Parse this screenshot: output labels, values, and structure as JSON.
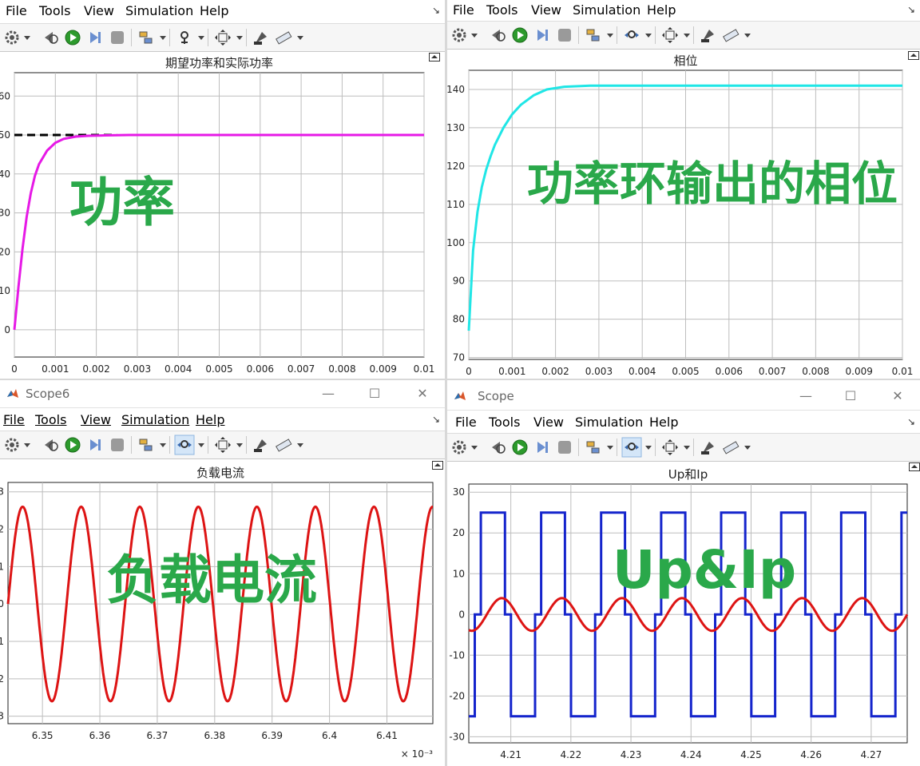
{
  "menu": {
    "file": "File",
    "tools": "Tools",
    "view": "View",
    "simulation": "Simulation",
    "help": "Help"
  },
  "windows": {
    "scope6_title": "Scope6",
    "scope_title": "Scope",
    "minimize_glyph": "—",
    "maximize_glyph": "☐",
    "close_glyph": "✕",
    "dock_glyph": "↘"
  },
  "chart_data": [
    {
      "id": "power",
      "type": "line",
      "title": "期望功率和实际功率",
      "overlay": "功率",
      "xlim": [
        0,
        0.01
      ],
      "ylim": [
        -7,
        66
      ],
      "xticks": [
        0,
        0.001,
        0.002,
        0.003,
        0.004,
        0.005,
        0.006,
        0.007,
        0.008,
        0.009,
        0.01
      ],
      "xticklabels": [
        "0",
        "0.001",
        "0.002",
        "0.003",
        "0.004",
        "0.005",
        "0.006",
        "0.007",
        "0.008",
        "0.009",
        "0.01"
      ],
      "yticks": [
        0,
        10,
        20,
        30,
        40,
        50,
        60
      ],
      "yticklabels": [
        "0",
        "10",
        "20",
        "30",
        "40",
        "50",
        "60"
      ],
      "grid": true,
      "series": [
        {
          "color": "#000000",
          "dash": "10,6",
          "x": [
            0,
            0.0025
          ],
          "y": [
            50,
            50
          ]
        },
        {
          "color": "#e619e6",
          "x": [
            0,
            0.0001,
            0.0002,
            0.0003,
            0.0004,
            0.0005,
            0.0006,
            0.0008,
            0.001,
            0.0012,
            0.0015,
            0.0018,
            0.0022,
            0.0028,
            0.0035,
            0.0045,
            0.006,
            0.008,
            0.01
          ],
          "y": [
            0,
            11,
            21,
            29,
            35,
            39.5,
            42.5,
            46,
            48,
            49,
            49.6,
            49.8,
            49.9,
            50,
            50,
            50,
            50,
            50,
            50
          ]
        }
      ]
    },
    {
      "id": "phase",
      "type": "line",
      "title": "相位",
      "overlay": "功率环输出的相位",
      "xlim": [
        0,
        0.01
      ],
      "ylim": [
        69.5,
        145
      ],
      "xticks": [
        0,
        0.001,
        0.002,
        0.003,
        0.004,
        0.005,
        0.006,
        0.007,
        0.008,
        0.009,
        0.01
      ],
      "xticklabels": [
        "0",
        "0.001",
        "0.002",
        "0.003",
        "0.004",
        "0.005",
        "0.006",
        "0.007",
        "0.008",
        "0.009",
        "0.01"
      ],
      "yticks": [
        70,
        80,
        90,
        100,
        110,
        120,
        130,
        140
      ],
      "yticklabels": [
        "70",
        "80",
        "90",
        "100",
        "110",
        "120",
        "130",
        "140"
      ],
      "grid": true,
      "series": [
        {
          "color": "#20e6e6",
          "x": [
            0,
            0.0001,
            0.0002,
            0.0003,
            0.0004,
            0.0005,
            0.0006,
            0.0008,
            0.001,
            0.0012,
            0.0015,
            0.0018,
            0.0022,
            0.0028,
            0.0035,
            0.0045,
            0.006,
            0.008,
            0.01
          ],
          "y": [
            77,
            98,
            108,
            114.5,
            119,
            122.5,
            125.5,
            130,
            133.5,
            136,
            138.5,
            140,
            140.7,
            141,
            141,
            141,
            141,
            141,
            141
          ]
        }
      ]
    },
    {
      "id": "current",
      "type": "line",
      "title": "负载电流",
      "overlay": "负载电流",
      "xlim": [
        0.006344,
        0.006418
      ],
      "ylim": [
        -3.2,
        3.25
      ],
      "xticks": [
        0.00635,
        0.00636,
        0.00637,
        0.00638,
        0.00639,
        0.0064,
        0.00641
      ],
      "xticklabels": [
        "6.35",
        "6.36",
        "6.37",
        "6.38",
        "6.39",
        "6.4",
        "6.41"
      ],
      "yticks": [
        3,
        2,
        1,
        0,
        -1,
        -2,
        -3
      ],
      "yticklabels": [
        "3",
        "2",
        "1",
        "0",
        "1",
        "2",
        "3"
      ],
      "xexponent": "× 10⁻³",
      "grid": true,
      "series": [
        {
          "color": "#dd1414",
          "function": "sine",
          "amplitude": 2.6,
          "period": 1.02e-05,
          "phase_x": 0.006344
        }
      ]
    },
    {
      "id": "upip",
      "type": "line",
      "title": "Up和Ip",
      "overlay": "Up&Ip",
      "xlim": [
        0.04203,
        0.04276
      ],
      "ylim": [
        -31.5,
        32
      ],
      "xticks": [
        0.0421,
        0.0422,
        0.0423,
        0.0424,
        0.0425,
        0.0426,
        0.0427
      ],
      "xticklabels": [
        "4.21",
        "4.22",
        "4.23",
        "4.24",
        "4.25",
        "4.26",
        "4.27"
      ],
      "yticks": [
        30,
        20,
        10,
        0,
        -10,
        -20,
        -30
      ],
      "yticklabels": [
        "30",
        "20",
        "10",
        "0",
        "-10",
        "-20",
        "-30"
      ],
      "grid": true,
      "series": [
        {
          "color": "#1424cc",
          "function": "quasi-square",
          "amplitude": 25,
          "period": 0.0001,
          "phase_x": 0.04205,
          "zero_fraction": 0.1
        },
        {
          "color": "#dd1414",
          "function": "sine",
          "amplitude": 4,
          "period": 0.0001,
          "phase_x": 0.04206
        }
      ]
    }
  ]
}
